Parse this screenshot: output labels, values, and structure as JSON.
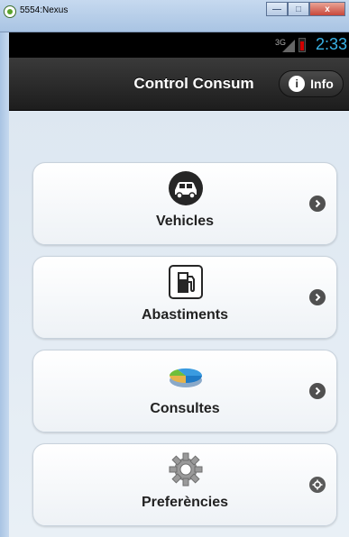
{
  "window": {
    "title": "5554:Nexus",
    "minimize": "—",
    "maximize": "□",
    "close": "x"
  },
  "statusbar": {
    "signal": "3G",
    "time": "2:33"
  },
  "header": {
    "title": "Control Consum",
    "info_label": "Info",
    "info_icon": "i"
  },
  "menu": [
    {
      "label": "Vehicles",
      "icon": "car-icon"
    },
    {
      "label": "Abastiments",
      "icon": "fuel-pump-icon"
    },
    {
      "label": "Consultes",
      "icon": "pie-chart-icon"
    },
    {
      "label": "Preferències",
      "icon": "gear-icon"
    }
  ],
  "colors": {
    "accent_clock": "#39b3e6",
    "appbar": "#2a2a2a",
    "battery": "#d20000"
  }
}
